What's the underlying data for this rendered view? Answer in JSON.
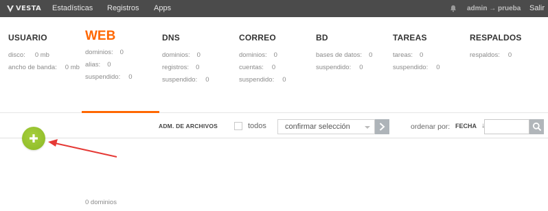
{
  "nav": {
    "logo_text": "VESTA",
    "items": [
      "Estadísticas",
      "Registros",
      "Apps"
    ],
    "user": "admin → prueba",
    "logout": "Salir",
    "icons": {
      "logo": "vesta-logo-icon",
      "notifications": "bell-icon"
    }
  },
  "panels": [
    {
      "title": "USUARIO",
      "rows": [
        {
          "label": "disco:",
          "value": "0 mb"
        },
        {
          "label": "ancho de banda:",
          "value": "0 mb"
        }
      ]
    },
    {
      "title": "WEB",
      "active": true,
      "rows": [
        {
          "label": "dominios:",
          "value": "0"
        },
        {
          "label": "alias:",
          "value": "0"
        },
        {
          "label": "suspendido:",
          "value": "0"
        }
      ]
    },
    {
      "title": "DNS",
      "rows": [
        {
          "label": "dominios:",
          "value": "0"
        },
        {
          "label": "registros:",
          "value": "0"
        },
        {
          "label": "suspendido:",
          "value": "0"
        }
      ]
    },
    {
      "title": "CORREO",
      "rows": [
        {
          "label": "dominios:",
          "value": "0"
        },
        {
          "label": "cuentas:",
          "value": "0"
        },
        {
          "label": "suspendido:",
          "value": "0"
        }
      ]
    },
    {
      "title": "BD",
      "rows": [
        {
          "label": "bases de datos:",
          "value": "0"
        },
        {
          "label": "suspendido:",
          "value": "0"
        }
      ]
    },
    {
      "title": "TAREAS",
      "rows": [
        {
          "label": "tareas:",
          "value": "0"
        },
        {
          "label": "suspendido:",
          "value": "0"
        }
      ]
    },
    {
      "title": "RESPALDOS",
      "rows": [
        {
          "label": "respaldos:",
          "value": "0"
        }
      ]
    }
  ],
  "toolbar": {
    "file_manager": "ADM. DE ARCHIVOS",
    "select_all": "todos",
    "bulk_action": "confirmar selección",
    "sort_label": "ordenar por:",
    "sort_value": "FECHA",
    "sort_direction": "↓",
    "search_value": "",
    "icons": {
      "apply": "chevron-right-icon",
      "search": "search-icon",
      "add": "plus-icon"
    }
  },
  "footer": {
    "count": "0 dominios"
  },
  "colors": {
    "accent": "#ff6701",
    "topbar": "#4b4b4b",
    "add_button": "#93bf2c",
    "annotation_arrow": "#e53935"
  }
}
